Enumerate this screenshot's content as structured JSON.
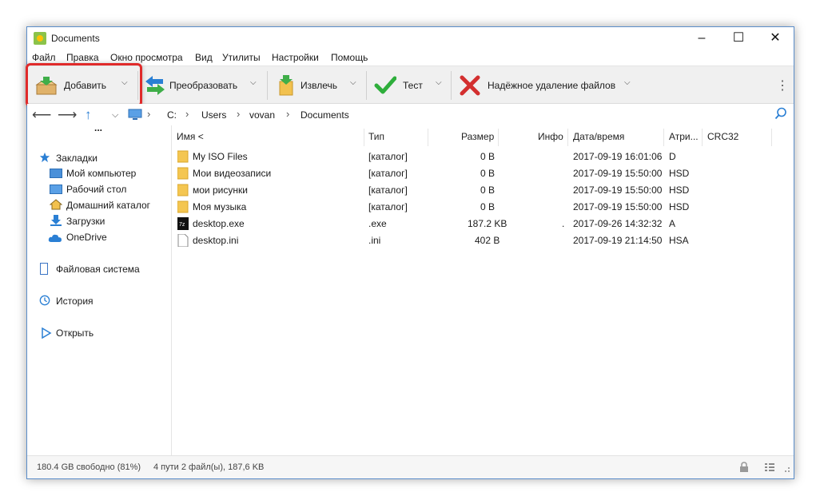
{
  "window": {
    "title": "Documents",
    "controls": [
      "–",
      "☐",
      "✕"
    ]
  },
  "menu": [
    "Файл",
    "Правка",
    "Окно просмотра",
    "Вид",
    "Утилиты",
    "Настройки",
    "Помощь"
  ],
  "toolbar": {
    "add": "Добавить",
    "convert": "Преобразовать",
    "extract": "Извлечь",
    "test": "Тест",
    "wipe": "Надёжное удаление файлов"
  },
  "address": {
    "path": [
      "C:",
      "Users",
      "vovan",
      "Documents"
    ]
  },
  "sidebar": {
    "ellipsis": "...",
    "bookmarks": "Закладки",
    "items": [
      "Мой компьютер",
      "Рабочий стол",
      "Домашний каталог",
      "Загрузки",
      "OneDrive"
    ],
    "filesystem": "Файловая система",
    "history": "История",
    "open": "Открыть"
  },
  "columns": [
    "Имя <",
    "Тип",
    "Размер",
    "Инфо",
    "Дата/время",
    "Атри...",
    "CRC32"
  ],
  "files": [
    {
      "name": "My ISO Files",
      "type": "[каталог]",
      "size": "0 B",
      "info": "",
      "date": "2017-09-19 16:01:06",
      "attr": "D",
      "icon": "folder-icon"
    },
    {
      "name": "Мои видеозаписи",
      "type": "[каталог]",
      "size": "0 B",
      "info": "",
      "date": "2017-09-19 15:50:00",
      "attr": "HSD",
      "icon": "folder-icon"
    },
    {
      "name": "мои рисунки",
      "type": "[каталог]",
      "size": "0 B",
      "info": "",
      "date": "2017-09-19 15:50:00",
      "attr": "HSD",
      "icon": "folder-icon"
    },
    {
      "name": "Моя музыка",
      "type": "[каталог]",
      "size": "0 B",
      "info": "",
      "date": "2017-09-19 15:50:00",
      "attr": "HSD",
      "icon": "folder-icon"
    },
    {
      "name": "desktop.exe",
      "type": ".exe",
      "size": "187.2 KB",
      "info": ".",
      "date": "2017-09-26 14:32:32",
      "attr": "A",
      "icon": "7zip-exe-icon"
    },
    {
      "name": "desktop.ini",
      "type": ".ini",
      "size": "402 B",
      "info": "",
      "date": "2017-09-19 21:14:50",
      "attr": "HSA",
      "icon": "file-icon"
    }
  ],
  "status": {
    "free": "180.4 GB свободно (81%)",
    "summary": "4 пути 2 файл(ы), 187,6 KB"
  }
}
